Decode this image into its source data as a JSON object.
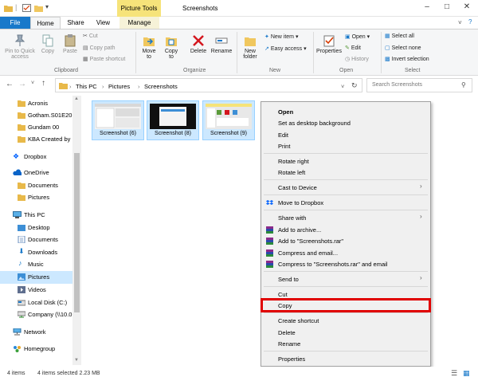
{
  "window": {
    "title": "Screenshots",
    "context_tab_group": "Picture Tools",
    "controls": {
      "minimize": "–",
      "maximize": "□",
      "close": "✕"
    }
  },
  "tabs": {
    "file": "File",
    "home": "Home",
    "share": "Share",
    "view": "View",
    "manage": "Manage"
  },
  "ribbon": {
    "pin": "Pin to Quick access",
    "copy": "Copy",
    "paste": "Paste",
    "cut": "Cut",
    "copy_path": "Copy path",
    "paste_shortcut": "Paste shortcut",
    "clipboard_label": "Clipboard",
    "move_to": "Move to",
    "copy_to": "Copy to",
    "delete": "Delete",
    "rename": "Rename",
    "organize_label": "Organize",
    "new_folder": "New folder",
    "new_item": "New item",
    "easy_access": "Easy access",
    "new_label": "New",
    "properties": "Properties",
    "open": "Open",
    "edit": "Edit",
    "history": "History",
    "open_label": "Open",
    "select_all": "Select all",
    "select_none": "Select none",
    "invert_selection": "Invert selection",
    "select_label": "Select"
  },
  "address": {
    "crumbs": [
      "This PC",
      "Pictures",
      "Screenshots"
    ],
    "search_placeholder": "Search Screenshots"
  },
  "nav": {
    "items": [
      "Acronis",
      "Gotham.S01E20.",
      "Gundam 00",
      "KBA Created by",
      "Dropbox",
      "OneDrive",
      "Documents",
      "Pictures",
      "This PC",
      "Desktop",
      "Documents",
      "Downloads",
      "Music",
      "Pictures",
      "Videos",
      "Local Disk (C:)",
      "Company (\\\\10.0",
      "Network",
      "Homegroup"
    ]
  },
  "files": [
    {
      "name": "Screenshot (6)"
    },
    {
      "name": "Screenshot (8)"
    },
    {
      "name": "Screenshot (9)"
    }
  ],
  "context_menu": {
    "open": "Open",
    "set_desktop_bg": "Set as desktop background",
    "edit": "Edit",
    "print": "Print",
    "rotate_right": "Rotate right",
    "rotate_left": "Rotate left",
    "cast_to_device": "Cast to Device",
    "move_to_dropbox": "Move to Dropbox",
    "share_with": "Share with",
    "add_to_archive": "Add to archive...",
    "add_to_rar": "Add to \"Screenshots.rar\"",
    "compress_email": "Compress and email...",
    "compress_rar_email": "Compress to \"Screenshots.rar\" and email",
    "send_to": "Send to",
    "cut": "Cut",
    "copy": "Copy",
    "create_shortcut": "Create shortcut",
    "delete": "Delete",
    "rename": "Rename",
    "properties": "Properties",
    "submenu_arrow": "›"
  },
  "status": {
    "item_count": "4 items",
    "selection": "4 items selected  2.23 MB"
  },
  "colors": {
    "accent": "#1979ca",
    "highlight": "#e00000",
    "selection": "#cce8ff",
    "picture_tools": "#f6e37a"
  }
}
